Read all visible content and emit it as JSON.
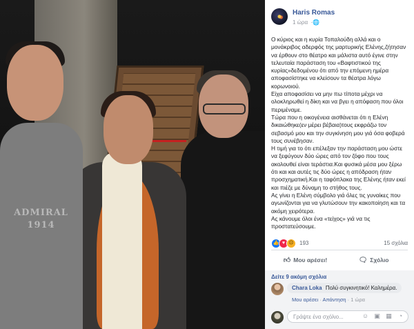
{
  "photo": {
    "shirt_print": [
      "ADMIRAL",
      "1914"
    ]
  },
  "post": {
    "author": "Haris Romas",
    "timestamp": "1 ώρα",
    "paragraphs": [
      "Ο κύριος και η κυρία Τοπαλούδη αλλά και ο μονάκριβος αδερφός της μαρτυρικής Ελένης,ζήτησαν να έρθουν στο θέατρο και μάλιστα αυτό έγινε στην τελευταία παράσταση του «Βαφτιστικού της κυρίας»δεδομένου ότι από την επόμενη ημέρα αποφασίστηκε να κλείσουν τα θέατρα λόγω κορωνοιού.",
      "Είχα αποφασίσει να μην πω τίποτα μέχρι να ολοκληρωθεί η δίκη και να βγει η απόφαση που όλοι περιμέναμε.",
      "Τώρα που η οικογένεια αισθάνεται ότι η Ελένη δικαιώθηκε(εν μέρει βέβαια)τους εκφράζω τον σεβασμό μου και την συγκίνηση μου γιά όσα φοβερά τους συνέβησαν.",
      "Η τιμή για το ότι επέλεξαν την παράσταση μου ώστε να ξεφύγουν δύο ώρες από τον ζόφο που τους ακολουθεί είναι τεράστια.Και φυσικά μέσα μου ξέρω ότι και και αυτές τις δύο ώρες η απόδραση ήταν προσχηματική.Και η ταφόπλακα της Ελένης ήταν εκεί και πιέζε με δύναμη το στήθος τους.",
      "Ας γίνει η Ελένη σύμβολο γιά όλες τις γυναίκες που αγωνίζονται για να γλυτώσουν την κακοποίηση και τα ακόμη χειρότερα.",
      "Ας κάνουμε όλοι ένα «τείχος» γιά να τις προστατεύσουμε."
    ],
    "reactions": {
      "count": "193",
      "comments": "15 σχόλια",
      "icons": [
        "like-icon",
        "love-icon",
        "sad-icon"
      ]
    },
    "actions": {
      "like_label": "Μου αρέσει!",
      "comment_label": "Σχόλιο"
    },
    "comments": {
      "more_label": "Δείτε 9 ακόμη σχόλια",
      "items": [
        {
          "name": "Chara Loka",
          "text": "Πολύ συγκινητικό! Καλημέρα.",
          "like": "Μου αρέσει",
          "reply": "Απάντηση",
          "time": "1 ώρα"
        }
      ],
      "write_placeholder": "Γράψτε ένα σχόλιο..."
    },
    "colors": {
      "link": "#385898",
      "muted": "#90949c",
      "like": "#1877f2"
    }
  }
}
